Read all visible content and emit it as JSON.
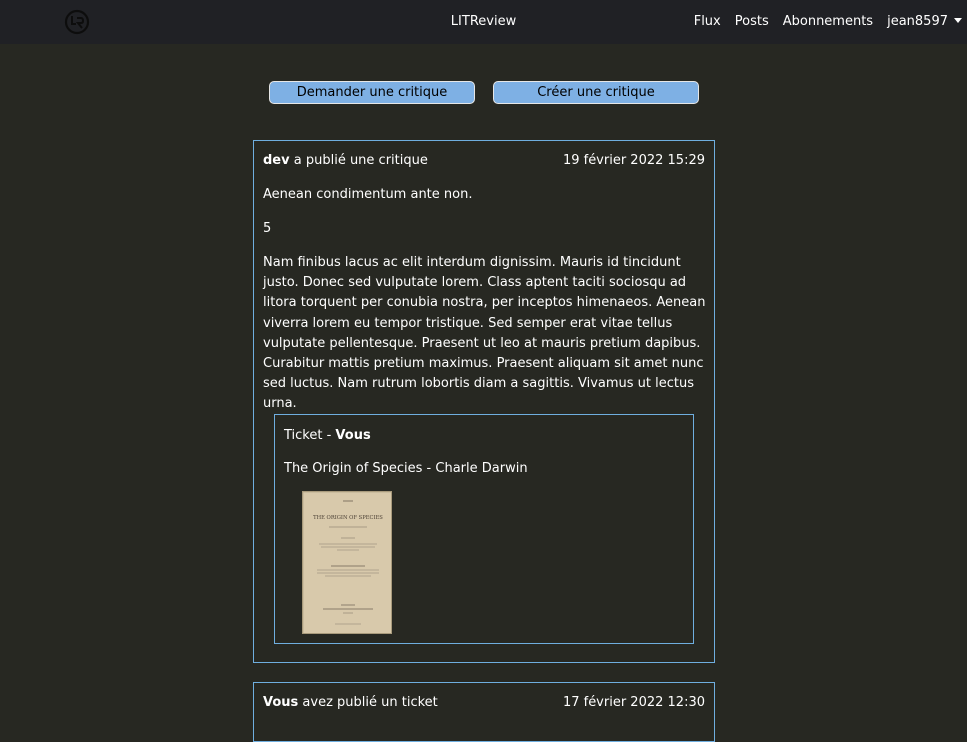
{
  "navbar": {
    "brand": "LITReview",
    "links": [
      "Flux",
      "Posts",
      "Abonnements"
    ],
    "user": "jean8597"
  },
  "actions": {
    "ask_review": "Demander une critique",
    "create_review": "Créer une critique"
  },
  "posts": [
    {
      "author": "dev",
      "action": "a publié une critique",
      "date": "19 février 2022 15:29",
      "headline": "Aenean condimentum ante non.",
      "rating": "5",
      "body": "Nam finibus lacus ac elit interdum dignissim. Mauris id tincidunt justo. Donec sed vulputate lorem. Class aptent taciti sociosqu ad litora torquent per conubia nostra, per inceptos himenaeos. Aenean viverra lorem eu tempor tristique. Sed semper erat vitae tellus vulputate pellentesque. Praesent ut leo at mauris pretium dapibus. Curabitur mattis pretium maximus. Praesent aliquam sit amet nunc sed luctus. Nam rutrum lobortis diam a sagittis. Vivamus ut lectus urna.",
      "ticket": {
        "label": "Ticket - ",
        "author": "Vous",
        "title": "The Origin of Species - Charle Darwin",
        "cover_title": "THE ORIGIN OF SPECIES"
      }
    },
    {
      "author": "Vous",
      "action": "avez publié un ticket",
      "date": "17 février 2022 12:30"
    }
  ]
}
